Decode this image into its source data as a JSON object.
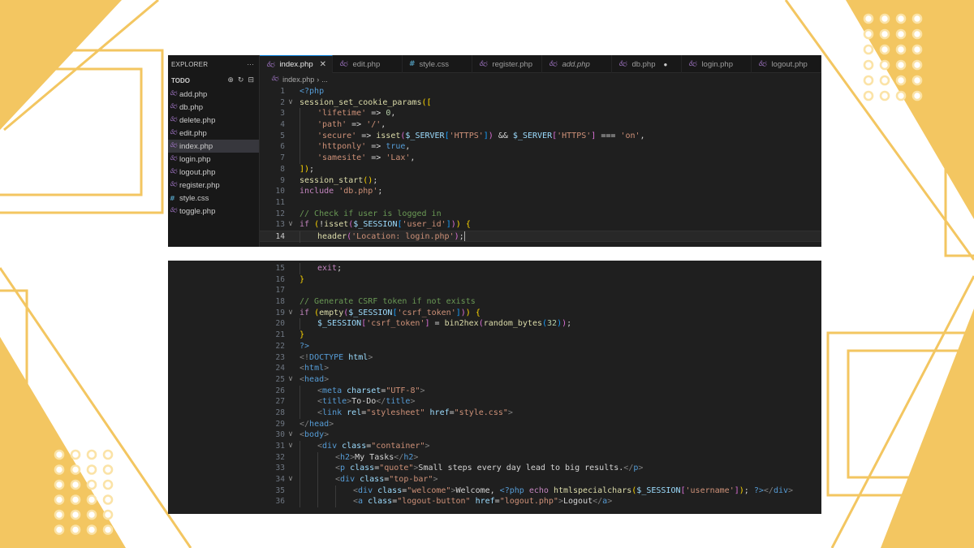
{
  "explorer": {
    "title": "EXPLORER",
    "more": "···",
    "section": "TODO",
    "section_actions": [
      "new-file-icon",
      "refresh-icon",
      "collapse-icon"
    ],
    "files": [
      {
        "name": "add.php",
        "type": "php"
      },
      {
        "name": "db.php",
        "type": "php"
      },
      {
        "name": "delete.php",
        "type": "php"
      },
      {
        "name": "edit.php",
        "type": "php"
      },
      {
        "name": "index.php",
        "type": "php",
        "active": true
      },
      {
        "name": "login.php",
        "type": "php"
      },
      {
        "name": "logout.php",
        "type": "php"
      },
      {
        "name": "register.php",
        "type": "php"
      },
      {
        "name": "style.css",
        "type": "css"
      },
      {
        "name": "toggle.php",
        "type": "php"
      }
    ]
  },
  "tabs": [
    {
      "label": "index.php",
      "type": "php",
      "active": true,
      "close": "✕"
    },
    {
      "label": "edit.php",
      "type": "php"
    },
    {
      "label": "style.css",
      "type": "css"
    },
    {
      "label": "register.php",
      "type": "php"
    },
    {
      "label": "add.php",
      "type": "php",
      "italic": true
    },
    {
      "label": "db.php",
      "type": "php",
      "dirty": true
    },
    {
      "label": "login.php",
      "type": "php"
    },
    {
      "label": "logout.php",
      "type": "php"
    }
  ],
  "breadcrumb": {
    "file": "index.php",
    "sep": "›",
    "rest": "..."
  },
  "editor": {
    "current_line": 14,
    "top_lines": [
      {
        "n": 1,
        "indent": 0,
        "tokens": [
          [
            "tag",
            "<?php"
          ]
        ]
      },
      {
        "n": 2,
        "indent": 0,
        "fold": "∨",
        "tokens": [
          [
            "fn",
            "session_set_cookie_params"
          ],
          [
            "br1",
            "(["
          ]
        ]
      },
      {
        "n": 3,
        "indent": 1,
        "tokens": [
          [
            "str",
            "'lifetime'"
          ],
          [
            "op",
            " => "
          ],
          [
            "num",
            "0"
          ],
          [
            "op",
            ","
          ]
        ]
      },
      {
        "n": 4,
        "indent": 1,
        "tokens": [
          [
            "str",
            "'path'"
          ],
          [
            "op",
            " => "
          ],
          [
            "str",
            "'/'"
          ],
          [
            "op",
            ","
          ]
        ]
      },
      {
        "n": 5,
        "indent": 1,
        "tokens": [
          [
            "str",
            "'secure'"
          ],
          [
            "op",
            " => "
          ],
          [
            "fn",
            "isset"
          ],
          [
            "br2",
            "("
          ],
          [
            "var",
            "$_SERVER"
          ],
          [
            "br3",
            "["
          ],
          [
            "str",
            "'HTTPS'"
          ],
          [
            "br3",
            "]"
          ],
          [
            "br2",
            ")"
          ],
          [
            "op",
            " && "
          ],
          [
            "var",
            "$_SERVER"
          ],
          [
            "br2",
            "["
          ],
          [
            "str",
            "'HTTPS'"
          ],
          [
            "br2",
            "]"
          ],
          [
            "op",
            " === "
          ],
          [
            "str",
            "'on'"
          ],
          [
            "op",
            ","
          ]
        ]
      },
      {
        "n": 6,
        "indent": 1,
        "tokens": [
          [
            "str",
            "'httponly'"
          ],
          [
            "op",
            " => "
          ],
          [
            "kwb",
            "true"
          ],
          [
            "op",
            ","
          ]
        ]
      },
      {
        "n": 7,
        "indent": 1,
        "tokens": [
          [
            "str",
            "'samesite'"
          ],
          [
            "op",
            " => "
          ],
          [
            "str",
            "'Lax'"
          ],
          [
            "op",
            ","
          ]
        ]
      },
      {
        "n": 8,
        "indent": 0,
        "tokens": [
          [
            "br1",
            "])"
          ],
          [
            "op",
            ";"
          ]
        ]
      },
      {
        "n": 9,
        "indent": 0,
        "tokens": [
          [
            "fn",
            "session_start"
          ],
          [
            "br1",
            "()"
          ],
          [
            "op",
            ";"
          ]
        ]
      },
      {
        "n": 10,
        "indent": 0,
        "tokens": [
          [
            "kw",
            "include"
          ],
          [
            "op",
            " "
          ],
          [
            "str",
            "'db.php'"
          ],
          [
            "op",
            ";"
          ]
        ]
      },
      {
        "n": 11,
        "indent": 0,
        "tokens": []
      },
      {
        "n": 12,
        "indent": 0,
        "tokens": [
          [
            "com",
            "// Check if user is logged in"
          ]
        ]
      },
      {
        "n": 13,
        "indent": 0,
        "fold": "∨",
        "tokens": [
          [
            "kw",
            "if"
          ],
          [
            "op",
            " "
          ],
          [
            "br1",
            "("
          ],
          [
            "op",
            "!"
          ],
          [
            "fn",
            "isset"
          ],
          [
            "br2",
            "("
          ],
          [
            "var",
            "$_SESSION"
          ],
          [
            "br3",
            "["
          ],
          [
            "str",
            "'user_id'"
          ],
          [
            "br3",
            "]"
          ],
          [
            "br2",
            ")"
          ],
          [
            "br1",
            ")"
          ],
          [
            "op",
            " "
          ],
          [
            "br1",
            "{"
          ]
        ]
      },
      {
        "n": 14,
        "indent": 1,
        "cursor": true,
        "tokens": [
          [
            "fn",
            "header"
          ],
          [
            "br2",
            "("
          ],
          [
            "str",
            "'Location: login.php'"
          ],
          [
            "br2",
            ")"
          ],
          [
            "op",
            ";"
          ]
        ]
      }
    ],
    "bottom_lines": [
      {
        "n": 15,
        "indent": 1,
        "tokens": [
          [
            "kw",
            "exit"
          ],
          [
            "op",
            ";"
          ]
        ]
      },
      {
        "n": 16,
        "indent": 0,
        "tokens": [
          [
            "br1",
            "}"
          ]
        ]
      },
      {
        "n": 17,
        "indent": 0,
        "tokens": []
      },
      {
        "n": 18,
        "indent": 0,
        "tokens": [
          [
            "com",
            "// Generate CSRF token if not exists"
          ]
        ]
      },
      {
        "n": 19,
        "indent": 0,
        "fold": "∨",
        "tokens": [
          [
            "kw",
            "if"
          ],
          [
            "op",
            " "
          ],
          [
            "br1",
            "("
          ],
          [
            "fn",
            "empty"
          ],
          [
            "br2",
            "("
          ],
          [
            "var",
            "$_SESSION"
          ],
          [
            "br3",
            "["
          ],
          [
            "str",
            "'csrf_token'"
          ],
          [
            "br3",
            "]"
          ],
          [
            "br2",
            ")"
          ],
          [
            "br1",
            ")"
          ],
          [
            "op",
            " "
          ],
          [
            "br1",
            "{"
          ]
        ]
      },
      {
        "n": 20,
        "indent": 1,
        "tokens": [
          [
            "var",
            "$_SESSION"
          ],
          [
            "br2",
            "["
          ],
          [
            "str",
            "'csrf_token'"
          ],
          [
            "br2",
            "]"
          ],
          [
            "op",
            " = "
          ],
          [
            "fn",
            "bin2hex"
          ],
          [
            "br2",
            "("
          ],
          [
            "fn",
            "random_bytes"
          ],
          [
            "br3",
            "("
          ],
          [
            "num",
            "32"
          ],
          [
            "br3",
            ")"
          ],
          [
            "br2",
            ")"
          ],
          [
            "op",
            ";"
          ]
        ]
      },
      {
        "n": 21,
        "indent": 0,
        "tokens": [
          [
            "br1",
            "}"
          ]
        ]
      },
      {
        "n": 22,
        "indent": 0,
        "tokens": [
          [
            "tag",
            "?>"
          ]
        ]
      },
      {
        "n": 23,
        "indent": 0,
        "tokens": [
          [
            "ang",
            "<!"
          ],
          [
            "htag",
            "DOCTYPE"
          ],
          [
            "op",
            " "
          ],
          [
            "attr",
            "html"
          ],
          [
            "ang",
            ">"
          ]
        ]
      },
      {
        "n": 24,
        "indent": 0,
        "tokens": [
          [
            "ang",
            "<"
          ],
          [
            "htag",
            "html"
          ],
          [
            "ang",
            ">"
          ]
        ]
      },
      {
        "n": 25,
        "indent": 0,
        "fold": "∨",
        "tokens": [
          [
            "ang",
            "<"
          ],
          [
            "htag",
            "head"
          ],
          [
            "ang",
            ">"
          ]
        ]
      },
      {
        "n": 26,
        "indent": 1,
        "tokens": [
          [
            "ang",
            "<"
          ],
          [
            "htag",
            "meta"
          ],
          [
            "op",
            " "
          ],
          [
            "attr",
            "charset"
          ],
          [
            "op",
            "="
          ],
          [
            "str",
            "\"UTF-8\""
          ],
          [
            "ang",
            ">"
          ]
        ]
      },
      {
        "n": 27,
        "indent": 1,
        "tokens": [
          [
            "ang",
            "<"
          ],
          [
            "htag",
            "title"
          ],
          [
            "ang",
            ">"
          ],
          [
            "op",
            "To-Do"
          ],
          [
            "ang",
            "</"
          ],
          [
            "htag",
            "title"
          ],
          [
            "ang",
            ">"
          ]
        ]
      },
      {
        "n": 28,
        "indent": 1,
        "tokens": [
          [
            "ang",
            "<"
          ],
          [
            "htag",
            "link"
          ],
          [
            "op",
            " "
          ],
          [
            "attr",
            "rel"
          ],
          [
            "op",
            "="
          ],
          [
            "str",
            "\"stylesheet\""
          ],
          [
            "op",
            " "
          ],
          [
            "attr",
            "href"
          ],
          [
            "op",
            "="
          ],
          [
            "str",
            "\"style.css\""
          ],
          [
            "ang",
            ">"
          ]
        ]
      },
      {
        "n": 29,
        "indent": 0,
        "tokens": [
          [
            "ang",
            "</"
          ],
          [
            "htag",
            "head"
          ],
          [
            "ang",
            ">"
          ]
        ]
      },
      {
        "n": 30,
        "indent": 0,
        "fold": "∨",
        "tokens": [
          [
            "ang",
            "<"
          ],
          [
            "htag",
            "body"
          ],
          [
            "ang",
            ">"
          ]
        ]
      },
      {
        "n": 31,
        "indent": 1,
        "fold": "∨",
        "tokens": [
          [
            "ang",
            "<"
          ],
          [
            "htag",
            "div"
          ],
          [
            "op",
            " "
          ],
          [
            "attr",
            "class"
          ],
          [
            "op",
            "="
          ],
          [
            "str",
            "\"container\""
          ],
          [
            "ang",
            ">"
          ]
        ]
      },
      {
        "n": 32,
        "indent": 2,
        "tokens": [
          [
            "ang",
            "<"
          ],
          [
            "htag",
            "h2"
          ],
          [
            "ang",
            ">"
          ],
          [
            "op",
            "My Tasks"
          ],
          [
            "ang",
            "</"
          ],
          [
            "htag",
            "h2"
          ],
          [
            "ang",
            ">"
          ]
        ]
      },
      {
        "n": 33,
        "indent": 2,
        "tokens": [
          [
            "ang",
            "<"
          ],
          [
            "htag",
            "p"
          ],
          [
            "op",
            " "
          ],
          [
            "attr",
            "class"
          ],
          [
            "op",
            "="
          ],
          [
            "str",
            "\"quote\""
          ],
          [
            "ang",
            ">"
          ],
          [
            "op",
            "Small steps every day lead to big results."
          ],
          [
            "ang",
            "</"
          ],
          [
            "htag",
            "p"
          ],
          [
            "ang",
            ">"
          ]
        ]
      },
      {
        "n": 34,
        "indent": 2,
        "fold": "∨",
        "tokens": [
          [
            "ang",
            "<"
          ],
          [
            "htag",
            "div"
          ],
          [
            "op",
            " "
          ],
          [
            "attr",
            "class"
          ],
          [
            "op",
            "="
          ],
          [
            "str",
            "\"top-bar\""
          ],
          [
            "ang",
            ">"
          ]
        ]
      },
      {
        "n": 35,
        "indent": 3,
        "tokens": [
          [
            "ang",
            "<"
          ],
          [
            "htag",
            "div"
          ],
          [
            "op",
            " "
          ],
          [
            "attr",
            "class"
          ],
          [
            "op",
            "="
          ],
          [
            "str",
            "\"welcome\""
          ],
          [
            "ang",
            ">"
          ],
          [
            "op",
            "Welcome, "
          ],
          [
            "tag",
            "<?php"
          ],
          [
            "op",
            " "
          ],
          [
            "kw",
            "echo"
          ],
          [
            "op",
            " "
          ],
          [
            "fn",
            "htmlspecialchars"
          ],
          [
            "br1",
            "("
          ],
          [
            "var",
            "$_SESSION"
          ],
          [
            "br2",
            "["
          ],
          [
            "str",
            "'username'"
          ],
          [
            "br2",
            "]"
          ],
          [
            "br1",
            ")"
          ],
          [
            "op",
            "; "
          ],
          [
            "tag",
            "?>"
          ],
          [
            "ang",
            "</"
          ],
          [
            "htag",
            "div"
          ],
          [
            "ang",
            ">"
          ]
        ]
      },
      {
        "n": 36,
        "indent": 3,
        "tokens": [
          [
            "ang",
            "<"
          ],
          [
            "htag",
            "a"
          ],
          [
            "op",
            " "
          ],
          [
            "attr",
            "class"
          ],
          [
            "op",
            "="
          ],
          [
            "str",
            "\"logout-button\""
          ],
          [
            "op",
            " "
          ],
          [
            "attr",
            "href"
          ],
          [
            "op",
            "="
          ],
          [
            "str",
            "\"logout.php\""
          ],
          [
            "ang",
            ">"
          ],
          [
            "op",
            "Logout"
          ],
          [
            "ang",
            "</"
          ],
          [
            "htag",
            "a"
          ],
          [
            "ang",
            ">"
          ]
        ]
      }
    ]
  },
  "colors": {
    "accent": "#f3c661",
    "editor_bg": "#1f1f1f",
    "sidebar_bg": "#181818"
  }
}
